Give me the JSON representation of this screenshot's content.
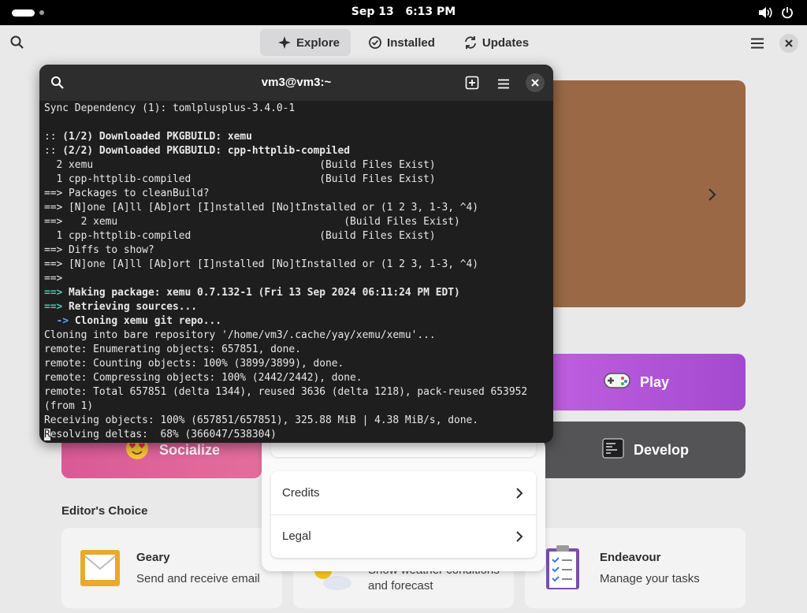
{
  "topbar": {
    "date": "Sep 13",
    "time": "6:13 PM"
  },
  "header": {
    "tabs": [
      {
        "label": "Explore",
        "icon": "compass-icon",
        "active": true
      },
      {
        "label": "Installed",
        "icon": "check-circle-icon",
        "active": false
      },
      {
        "label": "Updates",
        "icon": "refresh-icon",
        "active": false
      }
    ]
  },
  "categories": {
    "play": "Play",
    "develop": "Develop",
    "socialize": "Socialize"
  },
  "editors_choice": {
    "title": "Editor's Choice",
    "apps": [
      {
        "name": "Geary",
        "description": "Send and receive email",
        "icon": "mail-icon"
      },
      {
        "name": "",
        "description": "Show weather conditions and forecast",
        "icon": "weather-icon"
      },
      {
        "name": "Endeavour",
        "description": "Manage your tasks",
        "icon": "tasks-icon"
      }
    ]
  },
  "popover": {
    "rows": [
      "Credits",
      "Legal"
    ]
  },
  "terminal": {
    "title": "vm3@vm3:~",
    "lines": [
      [
        {
          "t": "Sync Dependency (1): tomlplusplus-3.4.0-1",
          "s": ""
        }
      ],
      [
        {
          "t": "",
          "s": ""
        }
      ],
      [
        {
          "t": ":: ",
          "s": ""
        },
        {
          "t": "(1/2) Downloaded PKGBUILD: xemu",
          "s": "b"
        }
      ],
      [
        {
          "t": ":: ",
          "s": ""
        },
        {
          "t": "(2/2) Downloaded PKGBUILD: cpp-httplib-compiled",
          "s": "b"
        }
      ],
      [
        {
          "t": "  2 xemu                                     (Build Files Exist)",
          "s": ""
        }
      ],
      [
        {
          "t": "  1 cpp-httplib-compiled                     (Build Files Exist)",
          "s": ""
        }
      ],
      [
        {
          "t": "==> Packages to cleanBuild?",
          "s": ""
        }
      ],
      [
        {
          "t": "==> [N]one [A]ll [Ab]ort [I]nstalled [No]tInstalled or (1 2 3, 1-3, ^4)",
          "s": ""
        }
      ],
      [
        {
          "t": "==>   2 xemu                                     (Build Files Exist)",
          "s": ""
        }
      ],
      [
        {
          "t": "  1 cpp-httplib-compiled                     (Build Files Exist)",
          "s": ""
        }
      ],
      [
        {
          "t": "==> Diffs to show?",
          "s": ""
        }
      ],
      [
        {
          "t": "==> [N]one [A]ll [Ab]ort [I]nstalled [No]tInstalled or (1 2 3, 1-3, ^4)",
          "s": ""
        }
      ],
      [
        {
          "t": "==>",
          "s": ""
        }
      ],
      [
        {
          "t": "==> ",
          "s": "g"
        },
        {
          "t": "Making package: xemu 0.7.132-1 (Fri 13 Sep 2024 06:11:24 PM EDT)",
          "s": "b"
        }
      ],
      [
        {
          "t": "==> ",
          "s": "g"
        },
        {
          "t": "Retrieving sources...",
          "s": "b"
        }
      ],
      [
        {
          "t": "  -> ",
          "s": "bl"
        },
        {
          "t": "Cloning xemu git repo...",
          "s": "b"
        }
      ],
      [
        {
          "t": "Cloning into bare repository '/home/vm3/.cache/yay/xemu/xemu'...",
          "s": ""
        }
      ],
      [
        {
          "t": "remote: Enumerating objects: 657851, done.",
          "s": ""
        }
      ],
      [
        {
          "t": "remote: Counting objects: 100% (3899/3899), done.",
          "s": ""
        }
      ],
      [
        {
          "t": "remote: Compressing objects: 100% (2442/2442), done.",
          "s": ""
        }
      ],
      [
        {
          "t": "remote: Total 657851 (delta 1344), reused 3636 (delta 1218), pack-reused 653952",
          "s": ""
        }
      ],
      [
        {
          "t": "(from 1)",
          "s": ""
        }
      ],
      [
        {
          "t": "Receiving objects: 100% (657851/657851), 325.88 MiB | 4.38 MiB/s, done.",
          "s": ""
        }
      ],
      [
        {
          "t": "R",
          "s": "cursor"
        },
        {
          "t": "esolving deltas:  68% (366047/538304)",
          "s": ""
        }
      ]
    ]
  }
}
